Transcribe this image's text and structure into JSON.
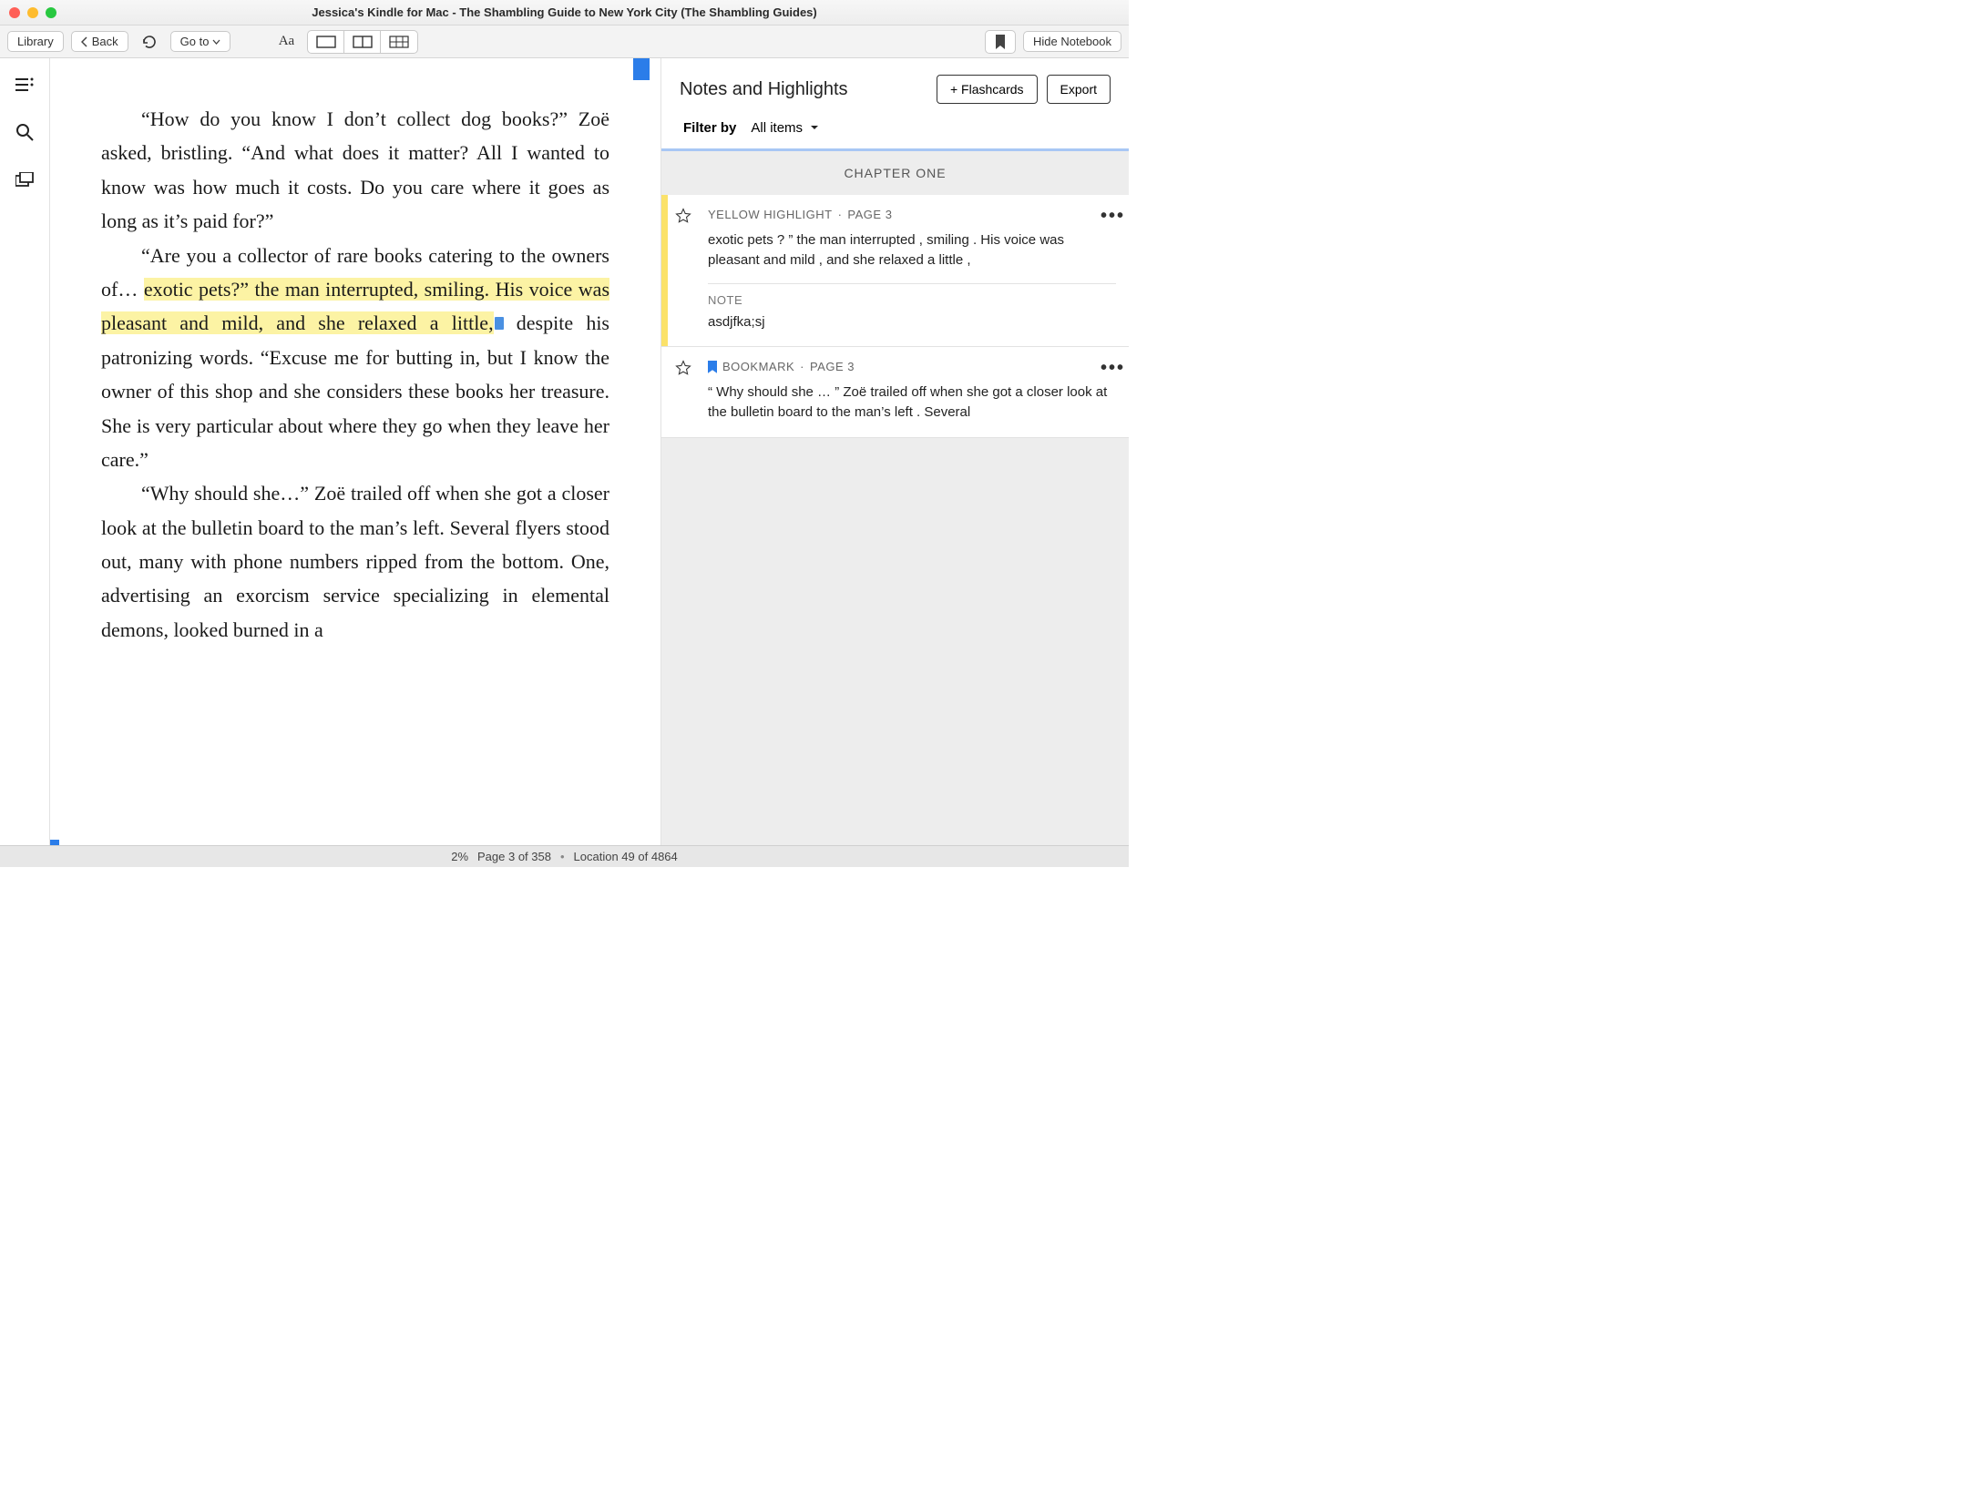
{
  "window": {
    "title": "Jessica's Kindle for Mac - The Shambling Guide to New York City (The Shambling Guides)"
  },
  "toolbar": {
    "library": "Library",
    "back": "Back",
    "goto": "Go to",
    "aa": "Aa",
    "hide_notebook": "Hide Notebook"
  },
  "reader": {
    "p1_before": "“How do you know I don’t collect dog books?” Zoë asked, bristling. “And what does it matter? All I wanted to know was how much it costs. Do you care where it goes as long as it’s paid for?”",
    "p2_before": "“Are you a collector of rare books catering to the owners of… ",
    "p2_highlight": "exotic pets?” the man interrupted, smiling. His voice was pleasant and mild, and she relaxed a little,",
    "p2_after": " despite his patronizing words. “Excuse me for butting in, but I know the owner of this shop and she considers these books her treasure. She is very particular about where they go when they leave her care.”",
    "p3": "“Why should she…” Zoë trailed off when she got a closer look at the bulletin board to the man’s left. Several flyers stood out, many with phone numbers ripped from the bottom. One, advertising an exorcism service specializing in elemental demons, looked burned in a"
  },
  "notebook": {
    "title": "Notes and Highlights",
    "flashcards": "+ Flashcards",
    "export": "Export",
    "filter_label": "Filter by",
    "filter_value": "All items",
    "chapter": "CHAPTER ONE",
    "items": [
      {
        "type_label": "YELLOW HIGHLIGHT",
        "page_label": "PAGE 3",
        "text": "exotic pets ? ” the man interrupted , smiling . His voice was pleasant and mild , and she relaxed a little ,",
        "note_label": "NOTE",
        "note_text": "asdjfka;sj",
        "stripe": "yellow"
      },
      {
        "type_label": "BOOKMARK",
        "page_label": "PAGE 3",
        "text": "“ Why should she … ” Zoë trailed off when she got a closer look at the bulletin board to the man’s left . Several",
        "bookmark": true
      }
    ]
  },
  "status": {
    "percent": "2%",
    "page": "Page 3 of 358",
    "location": "Location 49 of 4864"
  }
}
